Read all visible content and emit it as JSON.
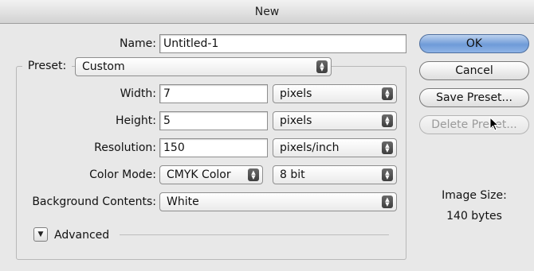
{
  "window": {
    "title": "New"
  },
  "name": {
    "label": "Name:",
    "value": "Untitled-1"
  },
  "preset": {
    "label": "Preset:",
    "value": "Custom"
  },
  "width": {
    "label": "Width:",
    "value": "7",
    "unit": "pixels"
  },
  "height": {
    "label": "Height:",
    "value": "5",
    "unit": "pixels"
  },
  "resolution": {
    "label": "Resolution:",
    "value": "150",
    "unit": "pixels/inch"
  },
  "color_mode": {
    "label": "Color Mode:",
    "value": "CMYK Color",
    "depth": "8 bit"
  },
  "background": {
    "label": "Background Contents:",
    "value": "White"
  },
  "advanced": {
    "label": "Advanced"
  },
  "buttons": {
    "ok": "OK",
    "cancel": "Cancel",
    "save_preset": "Save Preset...",
    "delete_preset": "Delete Preset..."
  },
  "image_size": {
    "label": "Image Size:",
    "value": "140 bytes"
  },
  "icons": {
    "popup": "up-down-arrows-icon",
    "disclosure": "triangle-down-icon",
    "cursor": "mouse-pointer-icon"
  },
  "colors": {
    "accent": "#6f9bd8"
  }
}
